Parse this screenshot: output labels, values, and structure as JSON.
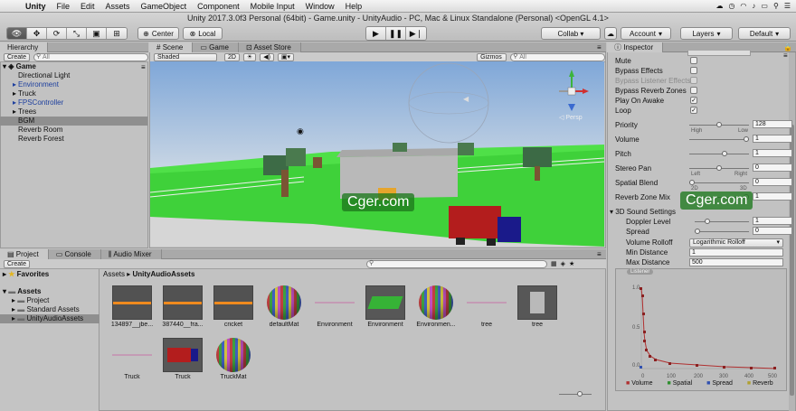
{
  "menubar": {
    "app": "Unity",
    "items": [
      "File",
      "Edit",
      "Assets",
      "GameObject",
      "Component",
      "Mobile Input",
      "Window",
      "Help"
    ]
  },
  "window_title": "Unity 2017.3.0f3 Personal (64bit) - Game.unity - UnityAudio - PC, Mac & Linux Standalone (Personal) <OpenGL 4.1>",
  "toolbar": {
    "pivot": "Center",
    "space": "Local",
    "collab": "Collab ▾",
    "account": "Account",
    "layers": "Layers",
    "layout": "Default"
  },
  "hierarchy": {
    "tab": "Hierarchy",
    "create": "Create",
    "search_placeholder": "All",
    "scene": "Game",
    "rows": [
      {
        "label": "Directional Light",
        "indent": 1,
        "arrow": false,
        "blue": false,
        "selected": false
      },
      {
        "label": "Environment",
        "indent": 1,
        "arrow": true,
        "blue": true,
        "selected": false
      },
      {
        "label": "Truck",
        "indent": 1,
        "arrow": true,
        "blue": false,
        "selected": false
      },
      {
        "label": "FPSController",
        "indent": 1,
        "arrow": true,
        "blue": true,
        "selected": false
      },
      {
        "label": "Trees",
        "indent": 1,
        "arrow": true,
        "blue": false,
        "selected": false
      },
      {
        "label": "BGM",
        "indent": 1,
        "arrow": false,
        "blue": false,
        "selected": true
      },
      {
        "label": "Reverb Room",
        "indent": 1,
        "arrow": false,
        "blue": false,
        "selected": false
      },
      {
        "label": "Reverb Forest",
        "indent": 1,
        "arrow": false,
        "blue": false,
        "selected": false
      }
    ]
  },
  "scene": {
    "tabs": [
      "Scene",
      "Game",
      "Asset Store"
    ],
    "shading": "Shaded",
    "mode_2d": "2D",
    "gizmos": "Gizmos ▾",
    "search_placeholder": "All"
  },
  "project": {
    "tabs": [
      "Project",
      "Console",
      "Audio Mixer"
    ],
    "create": "Create",
    "favorites": "Favorites",
    "tree": [
      {
        "label": "Assets",
        "indent": 0,
        "selected": false
      },
      {
        "label": "Project",
        "indent": 1,
        "selected": false
      },
      {
        "label": "Standard Assets",
        "indent": 1,
        "selected": false
      },
      {
        "label": "UnityAudioAssets",
        "indent": 1,
        "selected": true
      }
    ],
    "breadcrumb": [
      "Assets",
      "UnityAudioAssets"
    ],
    "assets": [
      {
        "label": "134897__jbe...",
        "kind": "audio"
      },
      {
        "label": "387440__fra...",
        "kind": "audio"
      },
      {
        "label": "cricket",
        "kind": "audio"
      },
      {
        "label": "defaultMat",
        "kind": "sphere"
      },
      {
        "label": "Environment",
        "kind": "line"
      },
      {
        "label": "Environment",
        "kind": "prefab-green"
      },
      {
        "label": "Environmen...",
        "kind": "sphere"
      },
      {
        "label": "tree",
        "kind": "line"
      },
      {
        "label": "tree",
        "kind": "prefab-gray"
      },
      {
        "label": "Truck",
        "kind": "line"
      },
      {
        "label": "Truck",
        "kind": "truck"
      },
      {
        "label": "TruckMat",
        "kind": "sphere"
      }
    ]
  },
  "inspector": {
    "tab": "Inspector",
    "checks": [
      {
        "label": "Mute",
        "checked": false,
        "dim": false
      },
      {
        "label": "Bypass Effects",
        "checked": false,
        "dim": false
      },
      {
        "label": "Bypass Listener Effects",
        "checked": false,
        "dim": true
      },
      {
        "label": "Bypass Reverb Zones",
        "checked": false,
        "dim": false
      },
      {
        "label": "Play On Awake",
        "checked": true,
        "dim": false
      },
      {
        "label": "Loop",
        "checked": true,
        "dim": false
      }
    ],
    "priority": {
      "label": "Priority",
      "value": "128",
      "low": "High",
      "high": "Low",
      "level": 0.5
    },
    "volume": {
      "label": "Volume",
      "value": "1",
      "level": 1.0
    },
    "pitch": {
      "label": "Pitch",
      "value": "1",
      "level": 0.6
    },
    "stereo_pan": {
      "label": "Stereo Pan",
      "value": "0",
      "low": "Left",
      "high": "Right",
      "level": 0.5
    },
    "spatial_blend": {
      "label": "Spatial Blend",
      "value": "0",
      "low": "2D",
      "high": "3D",
      "level": 0.0
    },
    "reverb_zone_mix": {
      "label": "Reverb Zone Mix",
      "value": "1",
      "level": 1.0
    },
    "sound3d": {
      "header": "3D Sound Settings",
      "doppler": {
        "label": "Doppler Level",
        "value": "1",
        "level": 0.2
      },
      "spread": {
        "label": "Spread",
        "value": "0",
        "level": 0.0
      },
      "rolloff": {
        "label": "Volume Rolloff",
        "value": "Logarithmic Rolloff"
      },
      "min_distance": {
        "label": "Min Distance",
        "value": "1"
      },
      "max_distance": {
        "label": "Max Distance",
        "value": "500"
      }
    },
    "graph": {
      "badge": "Listener",
      "y_ticks": [
        "1.0",
        "0.5",
        "0.0"
      ],
      "x_ticks": [
        "0",
        "100",
        "200",
        "300",
        "400",
        "500"
      ],
      "legend": [
        {
          "label": "Volume",
          "color": "#b03030"
        },
        {
          "label": "Spatial",
          "color": "#2f8f2f"
        },
        {
          "label": "Spread",
          "color": "#3050b0"
        },
        {
          "label": "Reverb",
          "color": "#b0a030"
        }
      ]
    }
  },
  "watermark": "Cger.com"
}
